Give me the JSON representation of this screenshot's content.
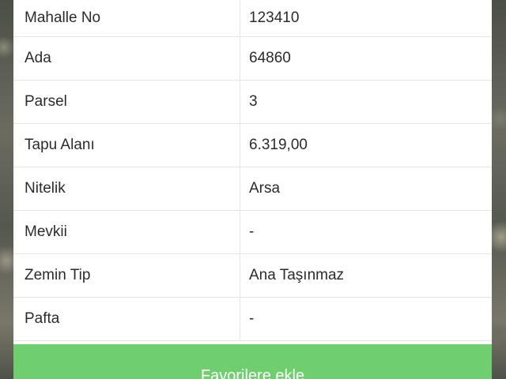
{
  "table": {
    "rows": [
      {
        "label": "Mahalle No",
        "value": "123410"
      },
      {
        "label": "Ada",
        "value": "64860"
      },
      {
        "label": "Parsel",
        "value": "3"
      },
      {
        "label": "Tapu Alanı",
        "value": "6.319,00"
      },
      {
        "label": "Nitelik",
        "value": "Arsa"
      },
      {
        "label": "Mevkii",
        "value": "-"
      },
      {
        "label": "Zemin Tip",
        "value": "Ana Taşınmaz"
      },
      {
        "label": "Pafta",
        "value": "-"
      }
    ]
  },
  "actions": {
    "favorite_label": "Favorilere ekle"
  },
  "colors": {
    "button_green": "#6fcf6f",
    "panel_bg": "#ffffff",
    "divider": "#e4e4e4"
  }
}
